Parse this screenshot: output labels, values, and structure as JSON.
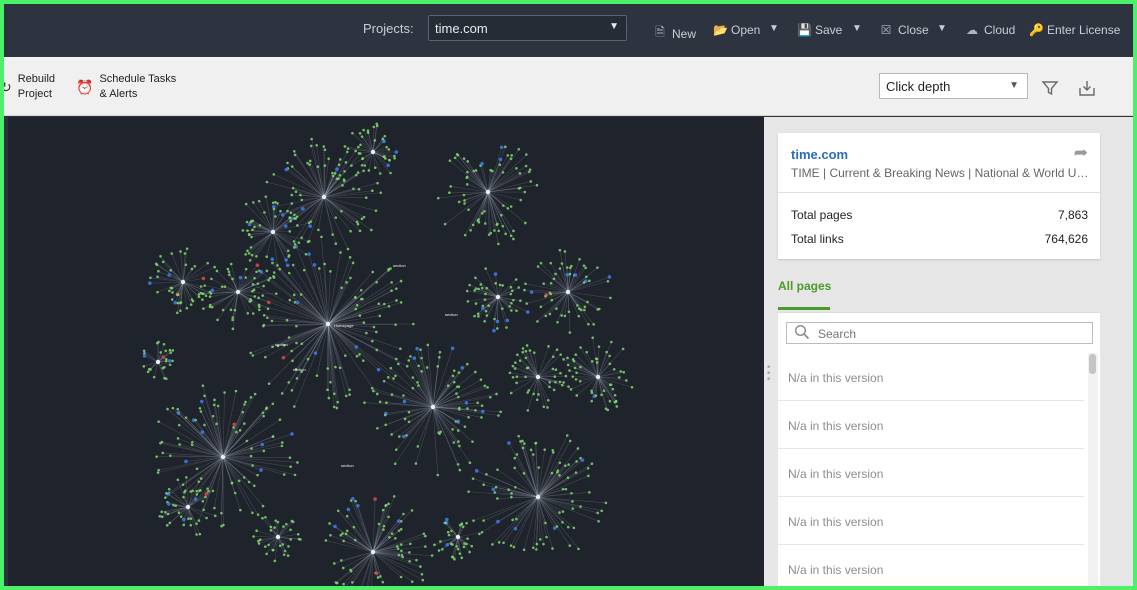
{
  "topbar": {
    "projects_label": "Projects:",
    "project_value": "time.com",
    "buttons": {
      "new": "New",
      "open": "Open",
      "save": "Save",
      "close": "Close",
      "cloud": "Cloud",
      "license": "Enter License"
    }
  },
  "toolbar": {
    "rebuild_line1": "Rebuild",
    "rebuild_line2": "Project",
    "schedule_line1": "Schedule Tasks",
    "schedule_line2": "& Alerts",
    "depth_value": "Click depth"
  },
  "graph": {
    "labels": [
      "Homepage",
      "section",
      "section",
      "section",
      "section",
      "section"
    ]
  },
  "summary": {
    "site": "time.com",
    "description": "TIME | Current & Breaking News | National & World Updates",
    "total_pages_label": "Total pages",
    "total_pages_value": "7,863",
    "total_links_label": "Total links",
    "total_links_value": "764,626"
  },
  "pages_tab": {
    "label": "All pages",
    "search_placeholder": "Search",
    "rows": [
      "N/a in this version",
      "N/a in this version",
      "N/a in this version",
      "N/a in this version",
      "N/a in this version"
    ]
  },
  "colors": {
    "accent_green": "#4a9b2a",
    "link_blue": "#2a6ebb",
    "node_green": "#7fd86e",
    "node_blue": "#3d7cf0",
    "node_red": "#e04545"
  }
}
